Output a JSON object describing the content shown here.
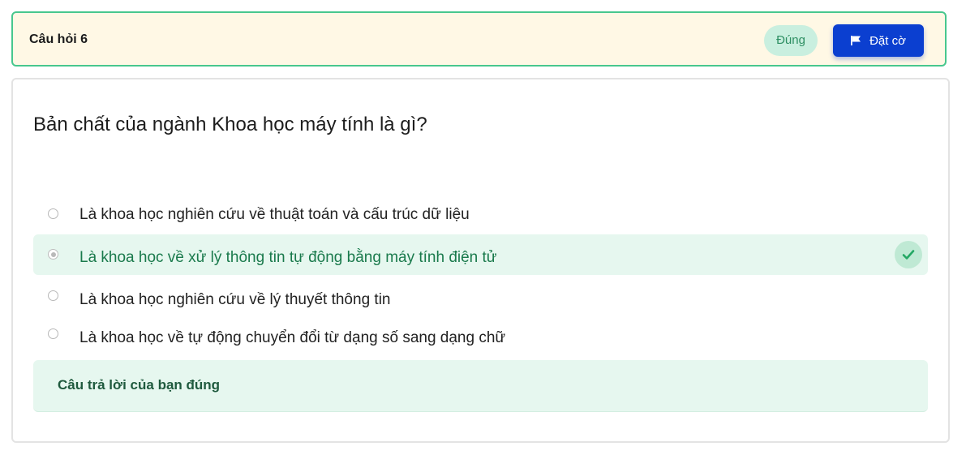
{
  "header": {
    "question_number": "Câu hỏi 6",
    "status": "Đúng",
    "flag_label": "Đặt cờ"
  },
  "question": {
    "text": "Bản chất của ngành Khoa học máy tính là gì?",
    "options": [
      {
        "label": "Là khoa học nghiên cứu về thuật toán và cấu trúc dữ liệu",
        "selected": false
      },
      {
        "label": "Là khoa học về xử lý thông tin tự động bằng máy tính điện tử",
        "selected": true,
        "correct": true
      },
      {
        "label": "Là khoa học nghiên cứu về lý thuyết thông tin",
        "selected": false
      },
      {
        "label": "Là khoa học về tự động chuyển đổi từ dạng số sang dạng chữ",
        "selected": false
      }
    ]
  },
  "feedback": {
    "text": "Câu trả lời của bạn đúng"
  },
  "colors": {
    "header_border": "#48c78e",
    "header_bg": "#fff8e5",
    "primary_button": "#0b3fd0",
    "correct_bg": "#e6f7ef",
    "correct_text": "#1a7a4c",
    "feedback_text": "#1f5a3e"
  },
  "icons": {
    "flag": "flag-icon",
    "check": "check-icon"
  }
}
